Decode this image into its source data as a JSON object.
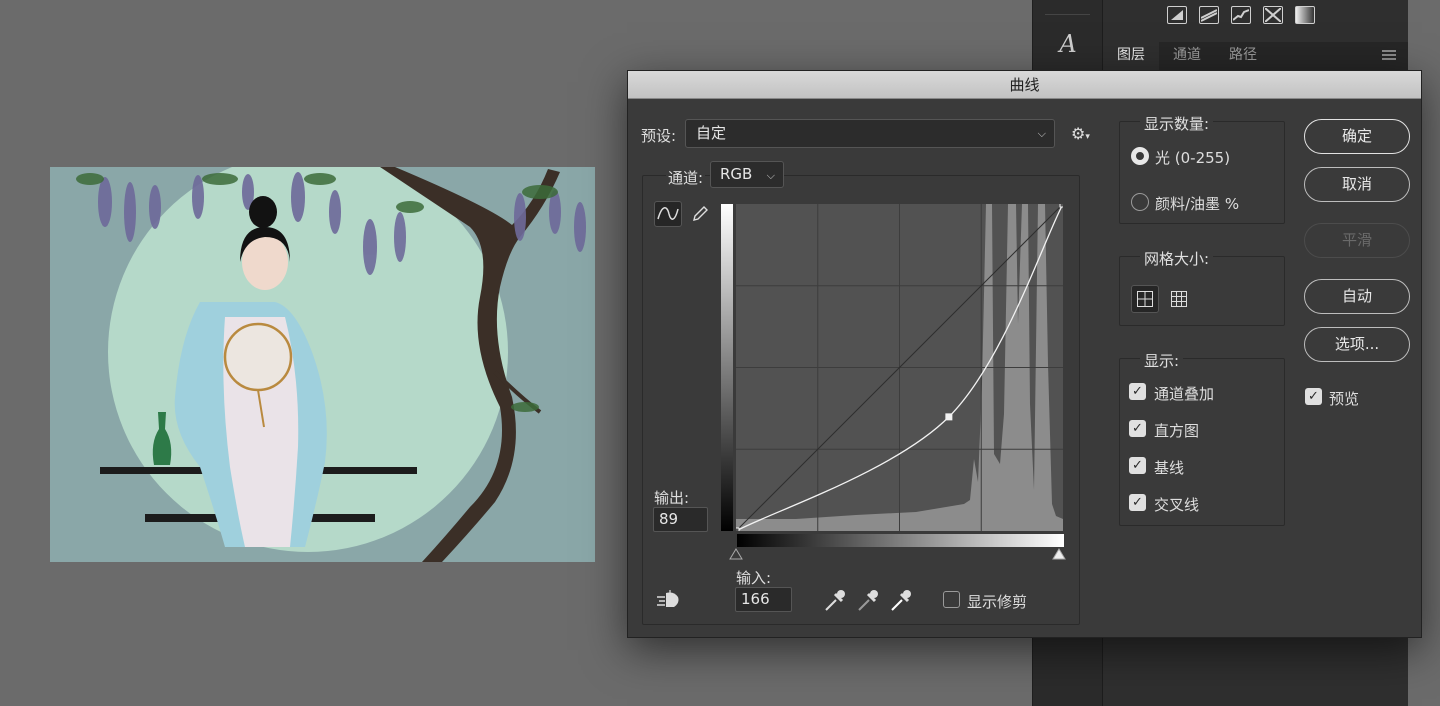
{
  "layers_panel": {
    "tabs": [
      "图层",
      "通道",
      "路径"
    ],
    "adjustment_icons": [
      "brightness-contrast-icon",
      "levels-icon",
      "curves-icon",
      "exposure-icon",
      "gradient-map-icon"
    ]
  },
  "tools": {
    "type_tool_glyph": "A"
  },
  "dialog": {
    "title": "曲线",
    "preset_label": "预设:",
    "preset_value": "自定",
    "channel_label": "通道:",
    "channel_value": "RGB",
    "output_label": "输出:",
    "output_value": "89",
    "input_label": "输入:",
    "input_value": "166",
    "show_clipping_label": "显示修剪",
    "show_clipping_checked": false,
    "curve": {
      "points": [
        [
          0,
          0
        ],
        [
          166,
          89
        ],
        [
          255,
          255
        ]
      ],
      "show_grid": true
    },
    "display_amount": {
      "title": "显示数量:",
      "options": [
        {
          "label": "光 (0-255)",
          "checked": true
        },
        {
          "label": "颜料/油墨 %",
          "checked": false
        }
      ]
    },
    "grid_size": {
      "title": "网格大小:",
      "selected": "simple"
    },
    "show": {
      "title": "显示:",
      "options": [
        {
          "label": "通道叠加",
          "checked": true
        },
        {
          "label": "直方图",
          "checked": true
        },
        {
          "label": "基线",
          "checked": true
        },
        {
          "label": "交叉线",
          "checked": true
        }
      ]
    },
    "buttons": {
      "ok": "确定",
      "cancel": "取消",
      "smooth": "平滑",
      "auto": "自动",
      "options": "选项..."
    },
    "preview_label": "预览",
    "preview_checked": true
  },
  "colors": {
    "dialog_bg": "#3a3a3a",
    "graph_bg": "#525252",
    "histogram": "#8c8c8c",
    "canvas_bg": "#6b6b6b",
    "artwork_bg": "#8aa7a8",
    "moon": "#b5d9c9"
  }
}
